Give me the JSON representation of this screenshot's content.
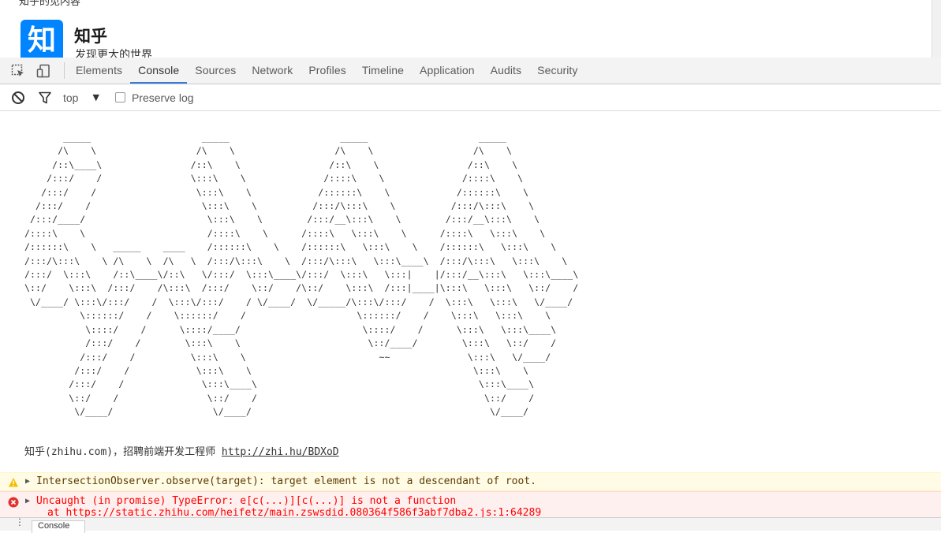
{
  "page": {
    "cut_text": "知乎的见内容",
    "logo_char": "知",
    "site_name": "知乎",
    "slogan": "发现更大的世界"
  },
  "devtools": {
    "tabs": [
      {
        "label": "Elements",
        "active": false
      },
      {
        "label": "Console",
        "active": true
      },
      {
        "label": "Sources",
        "active": false
      },
      {
        "label": "Network",
        "active": false
      },
      {
        "label": "Profiles",
        "active": false
      },
      {
        "label": "Timeline",
        "active": false
      },
      {
        "label": "Application",
        "active": false
      },
      {
        "label": "Audits",
        "active": false
      },
      {
        "label": "Security",
        "active": false
      }
    ],
    "accent_color": "#3879d9",
    "icons": {
      "inspect": "inspect-element-icon",
      "device": "device-mode-icon",
      "clear": "clear-console-icon",
      "filter": "filter-icon"
    }
  },
  "console_toolbar": {
    "context": "top",
    "preserve_log_label": "Preserve log",
    "preserve_log_checked": false
  },
  "console": {
    "ascii_art": "       _____                    _____                    _____                    _____\n      /\\    \\                  /\\    \\                  /\\    \\                  /\\    \\\n     /::\\____\\                /::\\    \\                /::\\    \\                /::\\    \\\n    /:::/    /                \\:::\\    \\              /::::\\    \\              /::::\\    \\\n   /:::/    /                  \\:::\\    \\            /::::::\\    \\            /::::::\\    \\\n  /:::/    /                    \\:::\\    \\          /:::/\\:::\\    \\          /:::/\\:::\\    \\\n /:::/____/                      \\:::\\    \\        /:::/__\\:::\\    \\        /:::/__\\:::\\    \\\n/::::\\    \\                      /::::\\    \\      /::::\\   \\:::\\    \\      /::::\\   \\:::\\    \\\n/::::::\\    \\   _____    ____    /::::::\\    \\    /::::::\\   \\:::\\    \\    /::::::\\   \\:::\\    \\\n/:::/\\:::\\    \\ /\\    \\  /\\   \\  /:::/\\:::\\    \\  /:::/\\:::\\   \\:::\\____\\  /:::/\\:::\\   \\:::\\    \\\n/:::/  \\:::\\    /::\\____\\/::\\   \\/:::/  \\:::\\____\\/:::/  \\:::\\   \\:::|    |/:::/__\\:::\\   \\:::\\____\\\n\\::/    \\:::\\  /:::/    /\\:::\\  /:::/    \\::/    /\\::/    \\:::\\  /:::|____|\\:::\\   \\:::\\   \\::/    /\n \\/____/ \\:::\\/:::/    /  \\:::\\/:::/    / \\/____/  \\/_____/\\:::\\/:::/    /  \\:::\\   \\:::\\   \\/____/\n          \\::::::/    /    \\::::::/    /                    \\::::::/    /    \\:::\\   \\:::\\    \\\n           \\::::/    /      \\::::/____/                      \\::::/    /      \\:::\\   \\:::\\____\\\n           /:::/    /        \\:::\\    \\                       \\::/____/        \\:::\\   \\::/    /\n          /:::/    /          \\:::\\    \\                        ~~              \\:::\\   \\/____/\n         /:::/    /            \\:::\\    \\                                        \\:::\\    \\\n        /:::/    /              \\:::\\____\\                                        \\:::\\____\\\n        \\::/    /                \\::/    /                                         \\::/    /\n         \\/____/                  \\/____/                                           \\/____/",
    "hire_text": "知乎(zhihu.com)，招聘前端开发工程师 ",
    "hire_link": "http://zhi.hu/BDXoD",
    "warning": "IntersectionObserver.observe(target): target element is not a descendant of root.",
    "error": "Uncaught (in promise) TypeError: e[c(...)][c(...)] is not a function",
    "error_stack": "    at https://static.zhihu.com/heifetz/main.zswsdid.080364f586f3abf7dba2.js:1:64289",
    "warn_color": "#fffbe5",
    "error_color": "#ff0000"
  },
  "drawer": {
    "tab_label": "Console"
  }
}
